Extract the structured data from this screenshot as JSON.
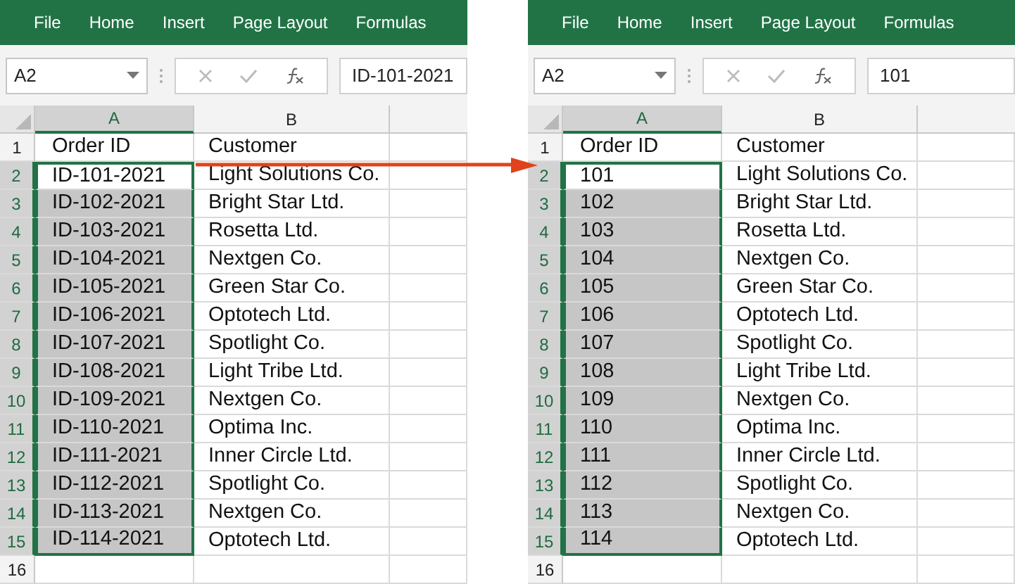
{
  "panels": [
    {
      "ribbon_tabs": [
        "File",
        "Home",
        "Insert",
        "Page Layout",
        "Formulas"
      ],
      "name_box": "A2",
      "formula_value": "ID-101-2021",
      "columns": [
        {
          "label": "A",
          "selected": true
        },
        {
          "label": "B",
          "selected": false
        }
      ],
      "rows": [
        {
          "number": "1",
          "selected": false,
          "active": false,
          "cells": [
            "Order ID",
            "Customer"
          ]
        },
        {
          "number": "2",
          "selected": true,
          "active": true,
          "cells": [
            "ID-101-2021",
            "Light Solutions Co."
          ]
        },
        {
          "number": "3",
          "selected": true,
          "active": false,
          "cells": [
            "ID-102-2021",
            "Bright Star Ltd."
          ]
        },
        {
          "number": "4",
          "selected": true,
          "active": false,
          "cells": [
            "ID-103-2021",
            "Rosetta Ltd."
          ]
        },
        {
          "number": "5",
          "selected": true,
          "active": false,
          "cells": [
            "ID-104-2021",
            "Nextgen Co."
          ]
        },
        {
          "number": "6",
          "selected": true,
          "active": false,
          "cells": [
            "ID-105-2021",
            "Green Star Co."
          ]
        },
        {
          "number": "7",
          "selected": true,
          "active": false,
          "cells": [
            "ID-106-2021",
            "Optotech Ltd."
          ]
        },
        {
          "number": "8",
          "selected": true,
          "active": false,
          "cells": [
            "ID-107-2021",
            "Spotlight Co."
          ]
        },
        {
          "number": "9",
          "selected": true,
          "active": false,
          "cells": [
            "ID-108-2021",
            "Light Tribe Ltd."
          ]
        },
        {
          "number": "10",
          "selected": true,
          "active": false,
          "cells": [
            "ID-109-2021",
            "Nextgen Co."
          ]
        },
        {
          "number": "11",
          "selected": true,
          "active": false,
          "cells": [
            "ID-110-2021",
            "Optima Inc."
          ]
        },
        {
          "number": "12",
          "selected": true,
          "active": false,
          "cells": [
            "ID-111-2021",
            "Inner Circle Ltd."
          ]
        },
        {
          "number": "13",
          "selected": true,
          "active": false,
          "cells": [
            "ID-112-2021",
            "Spotlight Co."
          ]
        },
        {
          "number": "14",
          "selected": true,
          "active": false,
          "cells": [
            "ID-113-2021",
            "Nextgen Co."
          ]
        },
        {
          "number": "15",
          "selected": true,
          "active": false,
          "cells": [
            "ID-114-2021",
            "Optotech Ltd."
          ]
        },
        {
          "number": "16",
          "selected": false,
          "active": false,
          "cells": []
        }
      ]
    },
    {
      "ribbon_tabs": [
        "File",
        "Home",
        "Insert",
        "Page Layout",
        "Formulas"
      ],
      "name_box": "A2",
      "formula_value": "101",
      "columns": [
        {
          "label": "A",
          "selected": true
        },
        {
          "label": "B",
          "selected": false
        }
      ],
      "rows": [
        {
          "number": "1",
          "selected": false,
          "active": false,
          "cells": [
            "Order ID",
            "Customer"
          ]
        },
        {
          "number": "2",
          "selected": true,
          "active": true,
          "cells": [
            "101",
            "Light Solutions Co."
          ]
        },
        {
          "number": "3",
          "selected": true,
          "active": false,
          "cells": [
            "102",
            "Bright Star Ltd."
          ]
        },
        {
          "number": "4",
          "selected": true,
          "active": false,
          "cells": [
            "103",
            "Rosetta Ltd."
          ]
        },
        {
          "number": "5",
          "selected": true,
          "active": false,
          "cells": [
            "104",
            "Nextgen Co."
          ]
        },
        {
          "number": "6",
          "selected": true,
          "active": false,
          "cells": [
            "105",
            "Green Star Co."
          ]
        },
        {
          "number": "7",
          "selected": true,
          "active": false,
          "cells": [
            "106",
            "Optotech Ltd."
          ]
        },
        {
          "number": "8",
          "selected": true,
          "active": false,
          "cells": [
            "107",
            "Spotlight Co."
          ]
        },
        {
          "number": "9",
          "selected": true,
          "active": false,
          "cells": [
            "108",
            "Light Tribe Ltd."
          ]
        },
        {
          "number": "10",
          "selected": true,
          "active": false,
          "cells": [
            "109",
            "Nextgen Co."
          ]
        },
        {
          "number": "11",
          "selected": true,
          "active": false,
          "cells": [
            "110",
            "Optima Inc."
          ]
        },
        {
          "number": "12",
          "selected": true,
          "active": false,
          "cells": [
            "111",
            "Inner Circle Ltd."
          ]
        },
        {
          "number": "13",
          "selected": true,
          "active": false,
          "cells": [
            "112",
            "Spotlight Co."
          ]
        },
        {
          "number": "14",
          "selected": true,
          "active": false,
          "cells": [
            "113",
            "Nextgen Co."
          ]
        },
        {
          "number": "15",
          "selected": true,
          "active": false,
          "cells": [
            "114",
            "Optotech Ltd."
          ]
        },
        {
          "number": "16",
          "selected": false,
          "active": false,
          "cells": []
        }
      ]
    }
  ]
}
